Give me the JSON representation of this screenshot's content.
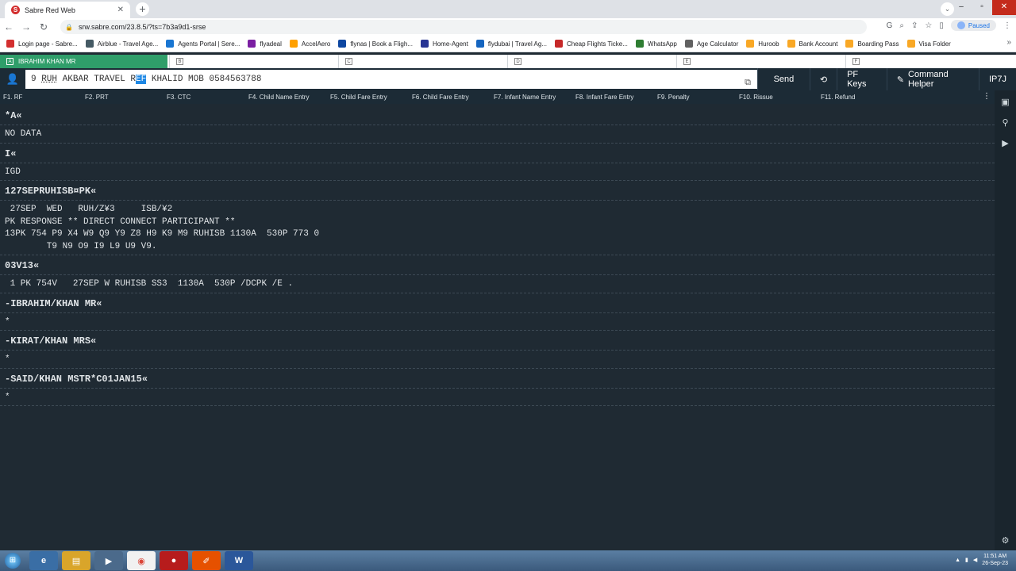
{
  "browser": {
    "tab_title": "Sabre Red Web",
    "url": "srw.sabre.com/23.8.5/?ts=7b3a9d1-srse",
    "profile_status": "Paused"
  },
  "bookmarks": [
    {
      "label": "Login page - Sabre...",
      "color": "#d32f2f"
    },
    {
      "label": "Airblue - Travel Age...",
      "color": "#455a64"
    },
    {
      "label": "Agents Portal | Sere...",
      "color": "#1976d2"
    },
    {
      "label": "flyadeal",
      "color": "#7b1fa2"
    },
    {
      "label": "AccelAero",
      "color": "#ffa000"
    },
    {
      "label": "flynas | Book a Fligh...",
      "color": "#0d47a1"
    },
    {
      "label": "Home-Agent",
      "color": "#283593"
    },
    {
      "label": "flydubai | Travel Ag...",
      "color": "#1565c0"
    },
    {
      "label": "Cheap Flights Ticke...",
      "color": "#c62828"
    },
    {
      "label": "WhatsApp",
      "color": "#2e7d32"
    },
    {
      "label": "Age Calculator",
      "color": "#616161"
    },
    {
      "label": "Huroob",
      "color": "#f9a825"
    },
    {
      "label": "Bank Account",
      "color": "#f9a825"
    },
    {
      "label": "Boarding Pass",
      "color": "#f9a825"
    },
    {
      "label": "Visa Folder",
      "color": "#f9a825"
    }
  ],
  "sessions": {
    "active": {
      "sq": "A",
      "label": "IBRAHIM KHAN MR"
    },
    "others": [
      "B",
      "C",
      "D",
      "E",
      "F"
    ]
  },
  "command": {
    "before": "9 ",
    "part1": "RUH",
    "part2": " AKBAR TRAVEL R",
    "selected": "EF",
    "after": " KHALID MOB 0584563788"
  },
  "buttons": {
    "send": "Send",
    "pf_keys": "PF Keys",
    "command_helper": "Command Helper",
    "pcc": "IP7J"
  },
  "pf_keys": [
    "F1. RF",
    "F2. PRT",
    "F3. CTC",
    "F4. Child Name Entry",
    "F5. Child Fare Entry",
    "F6. Child Fare Entry",
    "F7. Infant Name Entry",
    "F8. Infant Fare Entry",
    "F9. Penalty",
    "F10. Rissue",
    "F11. Refund"
  ],
  "responses": [
    {
      "cmd": "*A«",
      "out": "NO DATA"
    },
    {
      "cmd": "I«",
      "out": "IGD"
    },
    {
      "cmd": "127SEPRUHISB¤PK«",
      "out": " 27SEP  WED   RUH/Z¥3     ISB/¥2\nPK RESPONSE ** DIRECT CONNECT PARTICIPANT **\n13PK 754 P9 X4 W9 Q9 Y9 Z8 H9 K9 M9 RUHISB 1130A  530P 773 0\n        T9 N9 O9 I9 L9 U9 V9."
    },
    {
      "cmd": "03V13«",
      "out": " 1 PK 754V   27SEP W RUHISB SS3  1130A  530P /DCPK /E ."
    },
    {
      "cmd": "-IBRAHIM/KHAN MR«",
      "out": "*"
    },
    {
      "cmd": "-KIRAT/KHAN MRS«",
      "out": "*"
    },
    {
      "cmd": "-SAID/KHAN MSTR*C01JAN15«",
      "out": "*"
    }
  ],
  "taskbar": {
    "time": "11:51 AM",
    "date": "26-Sep-23"
  }
}
